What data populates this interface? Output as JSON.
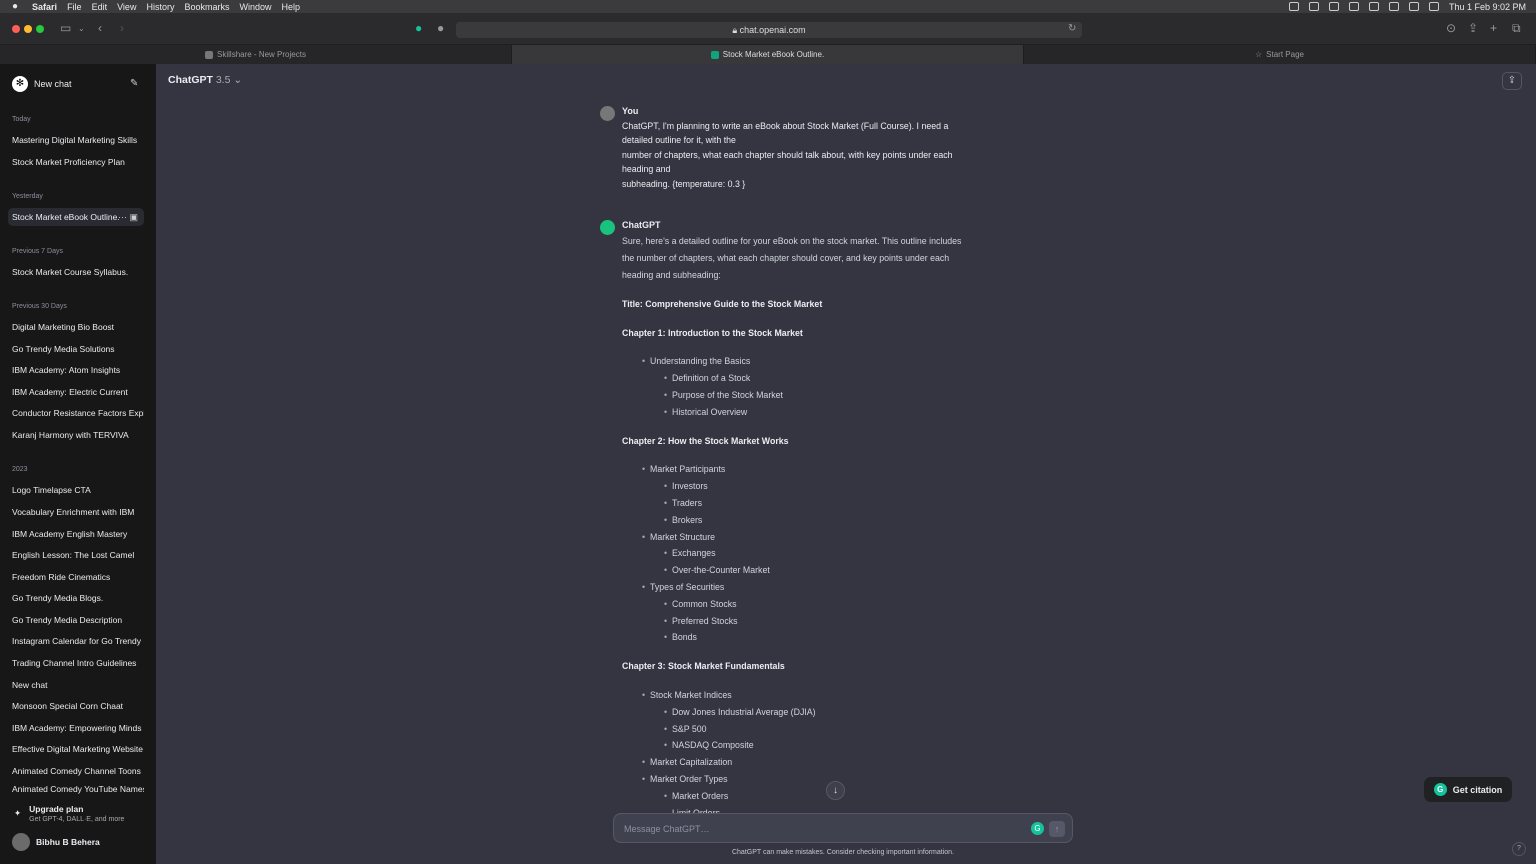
{
  "menubar": {
    "app": "Safari",
    "items": [
      "File",
      "Edit",
      "View",
      "History",
      "Bookmarks",
      "Window",
      "Help"
    ],
    "clock": "Thu 1 Feb  9:02 PM"
  },
  "browser": {
    "url": "chat.openai.com",
    "tabs": [
      {
        "label": "Skillshare - New Projects"
      },
      {
        "label": "Stock Market eBook Outline."
      },
      {
        "label": "Start Page"
      }
    ]
  },
  "sidebar": {
    "new_chat": "New chat",
    "groups": [
      {
        "label": "Today",
        "items": [
          "Mastering Digital Marketing Skills",
          "Stock Market Proficiency Plan"
        ]
      },
      {
        "label": "Yesterday",
        "items": [
          "Stock Market eBook Outline."
        ]
      },
      {
        "label": "Previous 7 Days",
        "items": [
          "Stock Market Course Syllabus."
        ]
      },
      {
        "label": "Previous 30 Days",
        "items": [
          "Digital Marketing Bio Boost",
          "Go Trendy Media Solutions",
          "IBM Academy: Atom Insights",
          "IBM Academy: Electric Current",
          "Conductor Resistance Factors Explained",
          "Karanj Harmony with TERVIVA"
        ]
      },
      {
        "label": "2023",
        "items": [
          "Logo Timelapse CTA",
          "Vocabulary Enrichment with IBM",
          "IBM Academy English Mastery",
          "English Lesson: The Lost Camel",
          "Freedom Ride Cinematics",
          "Go Trendy Media Blogs.",
          "Go Trendy Media Description",
          "Instagram Calendar for Go Trendy",
          "Trading Channel Intro Guidelines",
          "New chat",
          "Monsoon Special Corn Chaat",
          "IBM Academy: Empowering Minds",
          "Effective Digital Marketing Website",
          "Animated Comedy Channel Toons",
          "Animated Comedy YouTube Names"
        ]
      }
    ],
    "upgrade_title": "Upgrade plan",
    "upgrade_sub": "Get GPT-4, DALL·E, and more",
    "user_name": "Bibhu B Behera"
  },
  "main": {
    "model_name": "ChatGPT",
    "model_version": "3.5",
    "user_label": "You",
    "user_lines": [
      "ChatGPT, I'm planning to write an eBook about Stock Market (Full Course). I need a",
      "detailed outline for it, with the",
      "number of chapters, what each chapter should talk about, with key points under each",
      "heading and",
      "subheading. {temperature: 0.3 }"
    ],
    "assistant_label": "ChatGPT",
    "intro_lines": [
      "Sure, here's a detailed outline for your eBook on the stock market. This outline includes",
      "the number of chapters, what each chapter should cover, and key points under each",
      "heading and subheading:"
    ],
    "title": "Title: Comprehensive Guide to the Stock Market",
    "ch1": "Chapter 1: Introduction to the Stock Market",
    "ch1_items": [
      "Understanding the Basics",
      "Definition of a Stock",
      "Purpose of the Stock Market",
      "Historical Overview"
    ],
    "ch2": "Chapter 2: How the Stock Market Works",
    "ch2_items": [
      "Market Participants",
      "Investors",
      "Traders",
      "Brokers",
      "Market Structure",
      "Exchanges",
      "Over-the-Counter Market",
      "Types of Securities",
      "Common Stocks",
      "Preferred Stocks",
      "Bonds"
    ],
    "ch3": "Chapter 3: Stock Market Fundamentals",
    "ch3_items": [
      "Stock Market Indices",
      "Dow Jones Industrial Average (DJIA)",
      "S&P 500",
      "NASDAQ Composite",
      "Market Capitalization",
      "Market Order Types",
      "Market Orders",
      "Limit Orders"
    ],
    "citation": "Get citation",
    "input_placeholder": "Message ChatGPT…",
    "disclaimer": "ChatGPT can make mistakes. Consider checking important information."
  }
}
